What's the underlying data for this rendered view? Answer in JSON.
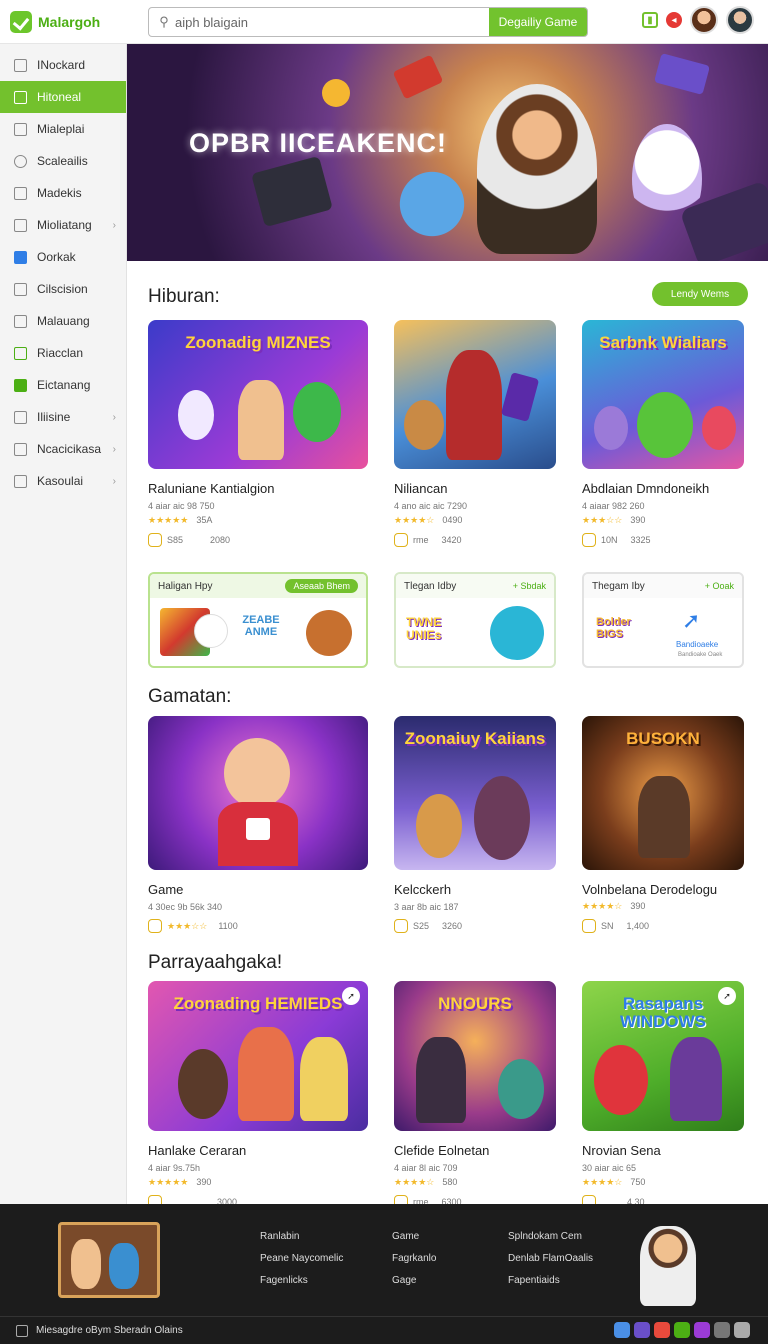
{
  "brand": {
    "name": "Malargoh",
    "accent": "#73c12d"
  },
  "search": {
    "value": "aiph blaigain",
    "button": "Degailiy Game"
  },
  "topbar": {
    "icons": [
      "grid-icon",
      "record-icon",
      "avatar",
      "avatar"
    ]
  },
  "sidebar": {
    "items": [
      {
        "label": "INockard",
        "icon": "square-icon",
        "chevron": false,
        "active": false
      },
      {
        "label": "Hitoneal",
        "icon": "square-icon",
        "chevron": false,
        "active": true
      },
      {
        "label": "Mialeplai",
        "icon": "grid-icon",
        "chevron": false,
        "active": false
      },
      {
        "label": "Scaleailis",
        "icon": "search-icon",
        "chevron": false,
        "active": false
      },
      {
        "label": "Madekis",
        "icon": "square-icon",
        "chevron": false,
        "active": false
      },
      {
        "label": "Mioliatang",
        "icon": "square-icon",
        "chevron": true,
        "active": false
      },
      {
        "label": "Oorkak",
        "icon": "blue-square-icon",
        "chevron": false,
        "active": false
      },
      {
        "label": "Cilscision",
        "icon": "square-icon",
        "chevron": false,
        "active": false
      },
      {
        "label": "Malauang",
        "icon": "square-icon",
        "chevron": false,
        "active": false
      },
      {
        "label": "Riacclan",
        "icon": "green-square-icon",
        "chevron": false,
        "active": false
      },
      {
        "label": "Eictanang",
        "icon": "green-triangle-icon",
        "chevron": false,
        "active": false
      },
      {
        "label": "Iliisine",
        "icon": "square-icon",
        "chevron": true,
        "active": false
      },
      {
        "label": "Ncacicikasa",
        "icon": "square-icon",
        "chevron": true,
        "active": false
      },
      {
        "label": "Kasoulai",
        "icon": "square-icon",
        "chevron": true,
        "active": false
      }
    ]
  },
  "hero": {
    "title": "OPBR IICEAKENC!"
  },
  "sections": {
    "s1": {
      "title": "Hiburan:",
      "button": "Lendy Wems"
    },
    "s2": {
      "title": "Gamatan:"
    },
    "s3": {
      "title": "Parrayaahgaka!"
    }
  },
  "cards_row1": [
    {
      "thumb_text": "Zoonadig MIZNES",
      "title": "Raluniane Kantialgion",
      "meta": "4 aiar aic 98 750",
      "rating": "★★★★★",
      "rating_count": "35A",
      "foot_a": "S85",
      "foot_b": "2080"
    },
    {
      "thumb_text": "",
      "title": "Niliancan",
      "meta": "4 ano aic aic 7290",
      "rating": "★★★★☆",
      "rating_count": "0490",
      "foot_a": "rme",
      "foot_b": "3420"
    },
    {
      "thumb_text": "Sarbnk Wialiars",
      "title": "Abdlaian Dmndoneikh",
      "meta": "4 aiaar 982 260",
      "rating": "★★★☆☆",
      "rating_count": "390",
      "foot_a": "10N",
      "foot_b": "3325"
    }
  ],
  "promos": [
    {
      "head": "Haligan Hpy",
      "tag": "Aseaab Bhem",
      "logo_text": "ZEABE ANME"
    },
    {
      "head": "Tlegan Idby",
      "tag": "+ Sbdak",
      "logo_text": "TWNE UNIEs"
    },
    {
      "head": "Thegam Iby",
      "tag": "+ Ooak",
      "logo_text": "Bolder BIGS",
      "sub_logo": "Bandioaeke",
      "sub_caption": "Bandioake Oaek"
    }
  ],
  "cards_row2": [
    {
      "thumb_text": "",
      "title": "Game",
      "meta": "4 30ec 9b 56k 340",
      "rating": "★★★☆☆",
      "rating_count": "",
      "foot_a": "",
      "foot_b": "1100"
    },
    {
      "thumb_text": "Zoonaiuy Kaiians",
      "title": "Kelcckerh",
      "meta": "3 aar 8b aic 187",
      "rating": "",
      "rating_count": "",
      "foot_a": "S25",
      "foot_b": "3260"
    },
    {
      "thumb_text": "BUSOKN",
      "title": "Volnbelana Derodelogu",
      "meta": "",
      "rating": "★★★★☆",
      "rating_count": "390",
      "foot_a": "SN",
      "foot_b": "1,400"
    }
  ],
  "cards_row3": [
    {
      "thumb_text": "Zoonading HEMIEDS",
      "title": "Hanlake Ceraran",
      "meta": "4 aiar 9s.75h",
      "rating": "★★★★★",
      "rating_count": "390",
      "foot_a": "",
      "foot_b": "3000"
    },
    {
      "thumb_text": "NNOURS",
      "title": "Clefide Eolnetan",
      "meta": "4 aiar 8l aic 709",
      "rating": "★★★★☆",
      "rating_count": "580",
      "foot_a": "rme",
      "foot_b": "6300"
    },
    {
      "thumb_text": "Rasapans WINDOWS",
      "title": "Nrovian Sena",
      "meta": "30 aiar aic 65",
      "rating": "★★★★☆",
      "rating_count": "750",
      "foot_a": "",
      "foot_b": "4,30"
    }
  ],
  "footer": {
    "col1": [
      "Ranlabin",
      "Peane Naycomelic",
      "Fagenlicks"
    ],
    "col2": [
      "Game",
      "Fagrkanlo",
      "Gage"
    ],
    "col3": [
      "Splndokam Cem",
      "Denlab FlamOaalis",
      "Fapentiaids"
    ],
    "bar": "Miesagdre  oBym  Sberadn Olains"
  },
  "colors": {
    "accent": "#73c12d",
    "footer_bg": "#1c1c1c",
    "star": "#f2b92b"
  }
}
